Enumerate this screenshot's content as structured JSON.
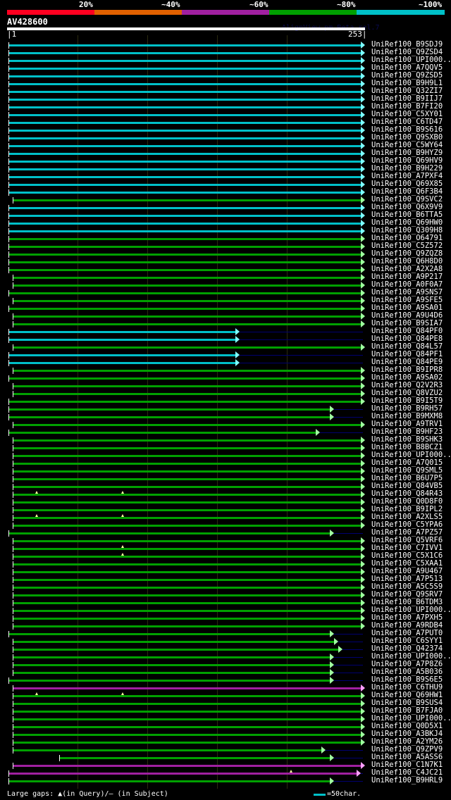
{
  "legend": {
    "labels": [
      "20%",
      "~40%",
      "~60%",
      "~80%",
      "~100%"
    ],
    "colors": [
      "#ff0020",
      "#e06000",
      "#a020a0",
      "#00a000",
      "#00c0c8"
    ]
  },
  "title": "AV428600",
  "brand": "AlignView.pm Beta rel.7",
  "query": {
    "start_label": "|1",
    "end_label": "253|",
    "length": 253
  },
  "colors": {
    "cyan": "#00c0c8",
    "green": "#00a000",
    "magenta": "#a020a0"
  },
  "hits": [
    {
      "name": "UniRef100_B9SDJ9",
      "c": "cyan",
      "s": 1,
      "e": 253
    },
    {
      "name": "UniRef100_Q9ZSD4",
      "c": "cyan",
      "s": 1,
      "e": 253
    },
    {
      "name": "UniRef100_UPI000..",
      "c": "cyan",
      "s": 1,
      "e": 253
    },
    {
      "name": "UniRef100_A7QQV5",
      "c": "cyan",
      "s": 1,
      "e": 253
    },
    {
      "name": "UniRef100_Q9ZSD5",
      "c": "cyan",
      "s": 1,
      "e": 253
    },
    {
      "name": "UniRef100_B9H9L1",
      "c": "cyan",
      "s": 1,
      "e": 253
    },
    {
      "name": "UniRef100_Q32ZI7",
      "c": "cyan",
      "s": 1,
      "e": 253
    },
    {
      "name": "UniRef100_B9IIJ7",
      "c": "cyan",
      "s": 1,
      "e": 253
    },
    {
      "name": "UniRef100_B7FI20",
      "c": "cyan",
      "s": 1,
      "e": 253
    },
    {
      "name": "UniRef100_C5XY01",
      "c": "cyan",
      "s": 1,
      "e": 253
    },
    {
      "name": "UniRef100_C6TD47",
      "c": "cyan",
      "s": 1,
      "e": 253
    },
    {
      "name": "UniRef100_B9S616",
      "c": "cyan",
      "s": 1,
      "e": 253
    },
    {
      "name": "UniRef100_Q9SXB0",
      "c": "cyan",
      "s": 1,
      "e": 253
    },
    {
      "name": "UniRef100_C5WY64",
      "c": "cyan",
      "s": 1,
      "e": 253
    },
    {
      "name": "UniRef100_B9HYZ9",
      "c": "cyan",
      "s": 1,
      "e": 253
    },
    {
      "name": "UniRef100_Q69HV9",
      "c": "cyan",
      "s": 1,
      "e": 253
    },
    {
      "name": "UniRef100_B9H229",
      "c": "cyan",
      "s": 1,
      "e": 253
    },
    {
      "name": "UniRef100_A7PXF4",
      "c": "cyan",
      "s": 1,
      "e": 253
    },
    {
      "name": "UniRef100_Q69X85",
      "c": "cyan",
      "s": 1,
      "e": 253
    },
    {
      "name": "UniRef100_Q6F3B4",
      "c": "cyan",
      "s": 1,
      "e": 253
    },
    {
      "name": "UniRef100_Q9SVC2",
      "c": "green",
      "s": 4,
      "e": 253
    },
    {
      "name": "UniRef100_Q6X9V9",
      "c": "cyan",
      "s": 1,
      "e": 253
    },
    {
      "name": "UniRef100_B6TTA5",
      "c": "cyan",
      "s": 1,
      "e": 253
    },
    {
      "name": "UniRef100_Q69HW0",
      "c": "cyan",
      "s": 1,
      "e": 253
    },
    {
      "name": "UniRef100_Q309H8",
      "c": "cyan",
      "s": 1,
      "e": 253
    },
    {
      "name": "UniRef100_O64791",
      "c": "green",
      "s": 1,
      "e": 253
    },
    {
      "name": "UniRef100_C5Z572",
      "c": "green",
      "s": 1,
      "e": 253
    },
    {
      "name": "UniRef100_Q9ZQZ8",
      "c": "green",
      "s": 1,
      "e": 253
    },
    {
      "name": "UniRef100_Q6H8D0",
      "c": "green",
      "s": 1,
      "e": 253
    },
    {
      "name": "UniRef100_A2X2A8",
      "c": "green",
      "s": 1,
      "e": 253
    },
    {
      "name": "UniRef100_A9P217",
      "c": "green",
      "s": 4,
      "e": 253
    },
    {
      "name": "UniRef100_A0F0A7",
      "c": "green",
      "s": 4,
      "e": 253
    },
    {
      "name": "UniRef100_A9SNS7",
      "c": "green",
      "s": 1,
      "e": 253
    },
    {
      "name": "UniRef100_A9SFE5",
      "c": "green",
      "s": 4,
      "e": 253
    },
    {
      "name": "UniRef100_A9SA01",
      "c": "green",
      "s": 1,
      "e": 253
    },
    {
      "name": "UniRef100_A9U4D6",
      "c": "green",
      "s": 4,
      "e": 253
    },
    {
      "name": "UniRef100_B9SIA7",
      "c": "green",
      "s": 4,
      "e": 253
    },
    {
      "name": "UniRef100_Q84PF0",
      "c": "cyan",
      "s": 1,
      "e": 164
    },
    {
      "name": "UniRef100_Q84PE8",
      "c": "cyan",
      "s": 1,
      "e": 164
    },
    {
      "name": "UniRef100_Q84L57",
      "c": "green",
      "s": 4,
      "e": 253
    },
    {
      "name": "UniRef100_Q84PF1",
      "c": "cyan",
      "s": 1,
      "e": 164
    },
    {
      "name": "UniRef100_Q84PE9",
      "c": "cyan",
      "s": 1,
      "e": 164
    },
    {
      "name": "UniRef100_B9IPR8",
      "c": "green",
      "s": 4,
      "e": 253
    },
    {
      "name": "UniRef100_A9SA02",
      "c": "green",
      "s": 1,
      "e": 253
    },
    {
      "name": "UniRef100_Q2V2R3",
      "c": "green",
      "s": 4,
      "e": 253
    },
    {
      "name": "UniRef100_Q8VZU2",
      "c": "green",
      "s": 4,
      "e": 253
    },
    {
      "name": "UniRef100_B9I5T9",
      "c": "green",
      "s": 1,
      "e": 253
    },
    {
      "name": "UniRef100_B9RH57",
      "c": "green",
      "s": 1,
      "e": 231
    },
    {
      "name": "UniRef100_B9MXM8",
      "c": "green",
      "s": 1,
      "e": 231
    },
    {
      "name": "UniRef100_A9TRV1",
      "c": "green",
      "s": 4,
      "e": 253
    },
    {
      "name": "UniRef100_B9HF23",
      "c": "green",
      "s": 1,
      "e": 221
    },
    {
      "name": "UniRef100_B9SHK3",
      "c": "green",
      "s": 4,
      "e": 253
    },
    {
      "name": "UniRef100_B8BCZ1",
      "c": "green",
      "s": 4,
      "e": 253
    },
    {
      "name": "UniRef100_UPI000..",
      "c": "green",
      "s": 4,
      "e": 253
    },
    {
      "name": "UniRef100_A7Q015",
      "c": "green",
      "s": 4,
      "e": 253
    },
    {
      "name": "UniRef100_Q9SML5",
      "c": "green",
      "s": 4,
      "e": 253
    },
    {
      "name": "UniRef100_B6U7P5",
      "c": "green",
      "s": 4,
      "e": 253
    },
    {
      "name": "UniRef100_Q84VB5",
      "c": "green",
      "s": 4,
      "e": 253
    },
    {
      "name": "UniRef100_Q84R43",
      "c": "green",
      "s": 4,
      "e": 253,
      "gaps": [
        21,
        82
      ]
    },
    {
      "name": "UniRef100_Q0D8F0",
      "c": "green",
      "s": 4,
      "e": 253
    },
    {
      "name": "UniRef100_B9IPL2",
      "c": "green",
      "s": 4,
      "e": 253
    },
    {
      "name": "UniRef100_A2XLS5",
      "c": "green",
      "s": 4,
      "e": 253,
      "gaps": [
        21,
        82
      ]
    },
    {
      "name": "UniRef100_C5YPA6",
      "c": "green",
      "s": 4,
      "e": 253
    },
    {
      "name": "UniRef100_A7PZ57",
      "c": "green",
      "s": 1,
      "e": 231
    },
    {
      "name": "UniRef100_Q5VRF6",
      "c": "green",
      "s": 4,
      "e": 253
    },
    {
      "name": "UniRef100_C7IVV1",
      "c": "green",
      "s": 4,
      "e": 253,
      "gaps": [
        82
      ]
    },
    {
      "name": "UniRef100_C5X1C6",
      "c": "green",
      "s": 4,
      "e": 253,
      "gaps": [
        82
      ]
    },
    {
      "name": "UniRef100_C5XAA1",
      "c": "green",
      "s": 4,
      "e": 253
    },
    {
      "name": "UniRef100_A9U467",
      "c": "green",
      "s": 4,
      "e": 253
    },
    {
      "name": "UniRef100_A7P513",
      "c": "green",
      "s": 4,
      "e": 253
    },
    {
      "name": "UniRef100_A5C5S9",
      "c": "green",
      "s": 4,
      "e": 253
    },
    {
      "name": "UniRef100_Q9SRV7",
      "c": "green",
      "s": 4,
      "e": 253
    },
    {
      "name": "UniRef100_B6TDM3",
      "c": "green",
      "s": 4,
      "e": 253
    },
    {
      "name": "UniRef100_UPI000..",
      "c": "green",
      "s": 4,
      "e": 253
    },
    {
      "name": "UniRef100_A7PXH5",
      "c": "green",
      "s": 4,
      "e": 253
    },
    {
      "name": "UniRef100_A9RDB4",
      "c": "green",
      "s": 4,
      "e": 253
    },
    {
      "name": "UniRef100_A7PUT0",
      "c": "green",
      "s": 1,
      "e": 231
    },
    {
      "name": "UniRef100_C6SYY1",
      "c": "green",
      "s": 4,
      "e": 234
    },
    {
      "name": "UniRef100_Q42374",
      "c": "green",
      "s": 4,
      "e": 237
    },
    {
      "name": "UniRef100_UPI000..",
      "c": "green",
      "s": 4,
      "e": 231
    },
    {
      "name": "UniRef100_A7P8Z6",
      "c": "green",
      "s": 4,
      "e": 231
    },
    {
      "name": "UniRef100_A5B036",
      "c": "green",
      "s": 4,
      "e": 231
    },
    {
      "name": "UniRef100_B9S6E5",
      "c": "green",
      "s": 1,
      "e": 231
    },
    {
      "name": "UniRef100_C6THU9",
      "c": "magenta",
      "s": 4,
      "e": 253
    },
    {
      "name": "UniRef100_Q69HW1",
      "c": "green",
      "s": 4,
      "e": 253,
      "gaps": [
        21,
        82
      ]
    },
    {
      "name": "UniRef100_B9SUS4",
      "c": "green",
      "s": 4,
      "e": 253
    },
    {
      "name": "UniRef100_B7FJA0",
      "c": "green",
      "s": 4,
      "e": 253
    },
    {
      "name": "UniRef100_UPI000..",
      "c": "green",
      "s": 4,
      "e": 253
    },
    {
      "name": "UniRef100_Q0D5X1",
      "c": "green",
      "s": 4,
      "e": 253
    },
    {
      "name": "UniRef100_A3BKJ4",
      "c": "green",
      "s": 4,
      "e": 253
    },
    {
      "name": "UniRef100_A2YM26",
      "c": "green",
      "s": 4,
      "e": 253
    },
    {
      "name": "UniRef100_Q9ZPV9",
      "c": "green",
      "s": 4,
      "e": 225
    },
    {
      "name": "UniRef100_A5ASS6",
      "c": "green",
      "s": 37,
      "e": 231
    },
    {
      "name": "UniRef100_C1N7K1",
      "c": "magenta",
      "s": 4,
      "e": 253
    },
    {
      "name": "UniRef100_C4JC21",
      "c": "magenta",
      "s": 1,
      "e": 250,
      "gaps": [
        202
      ]
    },
    {
      "name": "UniRef100_B9HRL9",
      "c": "green",
      "s": 1,
      "e": 231
    }
  ],
  "footer": {
    "text": "Large gaps: ▲(in Query)/— (in Subject)",
    "scale": "=50char."
  }
}
